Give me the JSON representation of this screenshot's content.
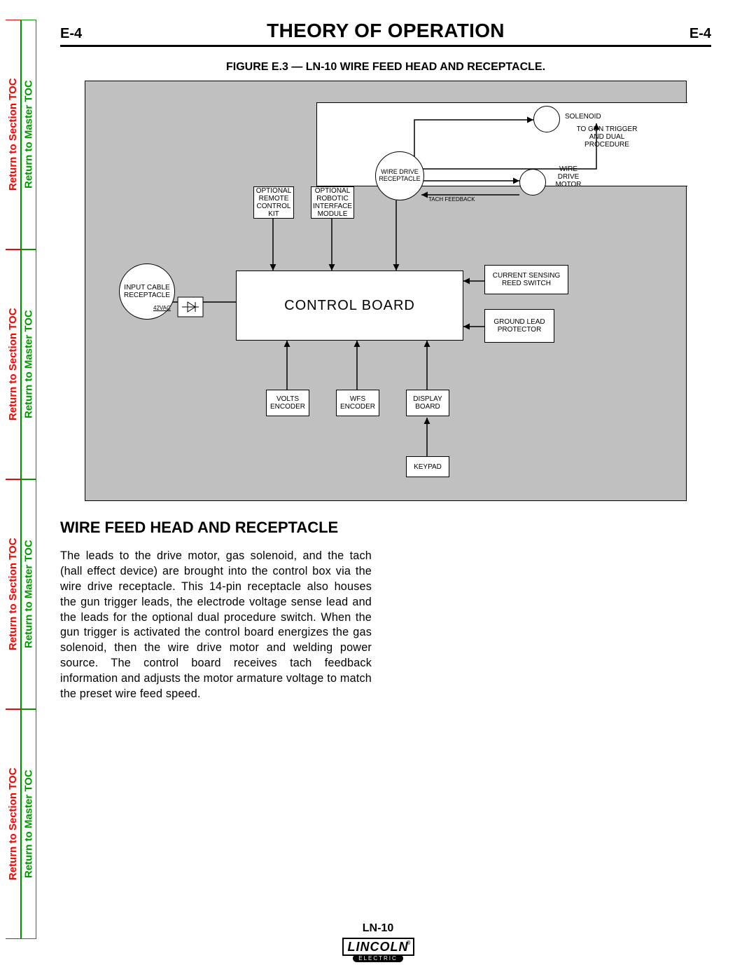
{
  "nav": {
    "section_toc": "Return to Section TOC",
    "master_toc": "Return to Master TOC"
  },
  "header": {
    "page_code": "E-4",
    "title": "THEORY OF OPERATION"
  },
  "figure": {
    "caption": "FIGURE E.3 — LN-10 WIRE FEED HEAD AND RECEPTACLE."
  },
  "diagram": {
    "control_board": "CONTROL BOARD",
    "optional_remote": "OPTIONAL REMOTE CONTROL KIT",
    "optional_robotic": "OPTIONAL ROBOTIC INTERFACE MODULE",
    "wire_drive_receptacle": "WIRE DRIVE RECEPTACLE",
    "solenoid": "SOLENOID",
    "to_gun": "TO GUN TRIGGER AND DUAL PROCEDURE",
    "wire_drive_motor": "WIRE DRIVE MOTOR",
    "tach_feedback": "TACH FEEDBACK",
    "input_cable": "INPUT CABLE RECEPTACLE",
    "v42": "42VAC",
    "current_sensing": "CURRENT  SENSING REED SWITCH",
    "ground_lead": "GROUND LEAD PROTECTOR",
    "volts_encoder": "VOLTS ENCODER",
    "wfs_encoder": "WFS ENCODER",
    "display_board": "DISPLAY BOARD",
    "keypad": "KEYPAD"
  },
  "section": {
    "heading": "WIRE FEED HEAD AND RECEPTACLE",
    "body": "The leads to the drive motor, gas solenoid, and the tach (hall effect device) are brought into the control box via the wire drive receptacle. This 14-pin receptacle also houses the gun trigger leads, the electrode voltage sense lead and the leads for the optional dual procedure switch.  When the gun trigger is activated the control board energizes the gas solenoid, then the wire drive motor and welding power source. The control board receives tach feedback information and adjusts the motor armature voltage to match the preset wire feed speed."
  },
  "footer": {
    "model": "LN-10",
    "brand_top": "LINCOLN",
    "brand_bot": "ELECTRIC",
    "reg": "®"
  }
}
